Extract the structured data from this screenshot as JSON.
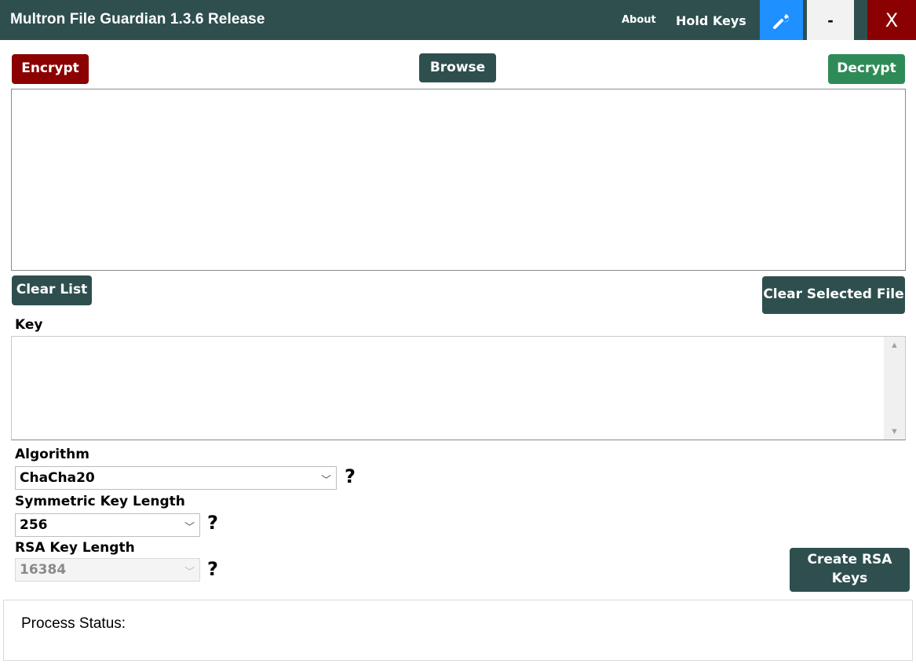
{
  "titlebar": {
    "title": "Multron File Guardian 1.3.6 Release",
    "about_label": "About",
    "hold_keys_label": "Hold Keys",
    "settings_icon": "wrench-icon",
    "minimize_label": "-",
    "close_label": "X"
  },
  "actions": {
    "encrypt_label": "Encrypt",
    "browse_label": "Browse",
    "decrypt_label": "Decrypt",
    "clear_list_label": "Clear List",
    "clear_selected_label": "Clear Selected File",
    "create_rsa_label": "Create RSA Keys"
  },
  "file_list": {
    "items": []
  },
  "key": {
    "label": "Key",
    "value": ""
  },
  "settings": {
    "algorithm_label": "Algorithm",
    "algorithm_value": "ChaCha20",
    "symmetric_label": "Symmetric Key Length",
    "symmetric_value": "256",
    "rsa_label": "RSA Key Length",
    "rsa_value": "16384",
    "help_glyph": "?"
  },
  "status": {
    "label": "Process Status:"
  },
  "colors": {
    "titlebar": "#2f4f4f",
    "encrypt": "#8b0000",
    "decrypt": "#2e8b57",
    "settings_button": "#1e90ff",
    "close_button": "#8b0000"
  }
}
